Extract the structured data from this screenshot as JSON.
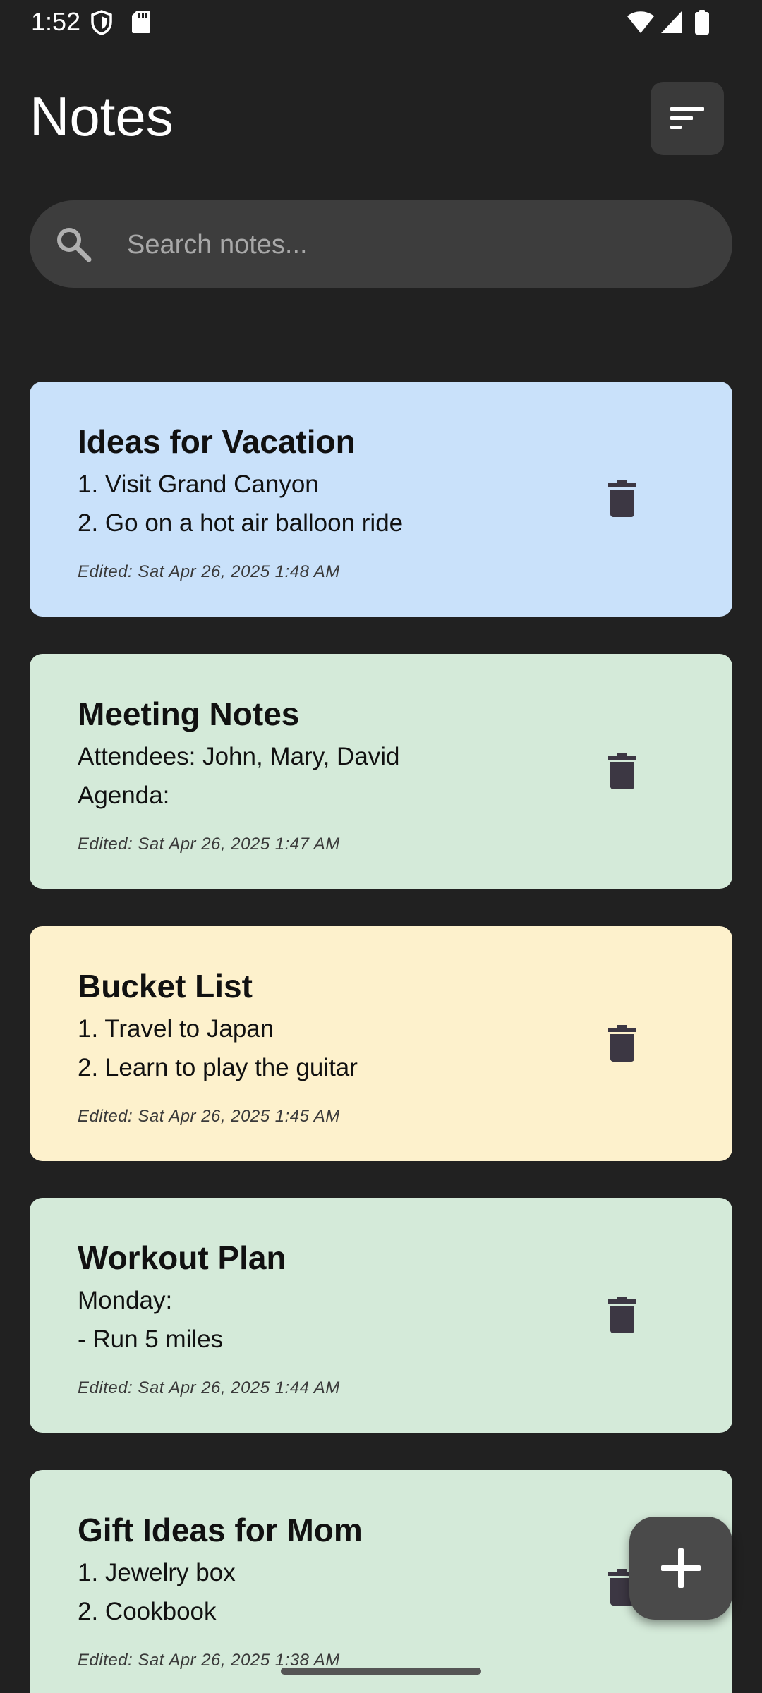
{
  "status_bar": {
    "time": "1:52",
    "icons": [
      "shield-icon",
      "sd-card-icon",
      "wifi-icon",
      "signal-icon",
      "battery-icon"
    ]
  },
  "header": {
    "title": "Notes",
    "sort_icon": "sort-icon"
  },
  "search": {
    "placeholder": "Search notes...",
    "value": ""
  },
  "notes": [
    {
      "title": "Ideas for Vacation",
      "line1": "1. Visit Grand Canyon",
      "line2": "2. Go on a hot air balloon ride",
      "edited": "Edited: Sat Apr 26, 2025 1:48 AM",
      "color": "#c9e1fa"
    },
    {
      "title": "Meeting Notes",
      "line1": "Attendees: John, Mary, David",
      "line2": "Agenda:",
      "edited": "Edited: Sat Apr 26, 2025 1:47 AM",
      "color": "#d4ead9"
    },
    {
      "title": "Bucket List",
      "line1": "1. Travel to Japan",
      "line2": "2. Learn to play the guitar",
      "edited": "Edited: Sat Apr 26, 2025 1:45 AM",
      "color": "#fdf1cc"
    },
    {
      "title": "Workout Plan",
      "line1": "Monday:",
      "line2": "- Run 5 miles",
      "edited": "Edited: Sat Apr 26, 2025 1:44 AM",
      "color": "#d4ead9"
    },
    {
      "title": "Gift Ideas for Mom",
      "line1": "1. Jewelry box",
      "line2": "2. Cookbook",
      "edited": "Edited: Sat Apr 26, 2025 1:38 AM",
      "color": "#d4ead9"
    }
  ],
  "fab": {
    "icon": "plus-icon"
  }
}
